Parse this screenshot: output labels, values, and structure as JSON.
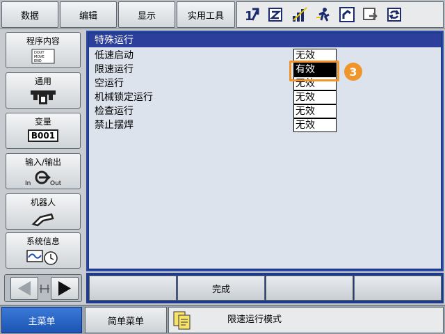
{
  "top_menu": {
    "items": [
      {
        "label": "数据"
      },
      {
        "label": "编辑"
      },
      {
        "label": "显示"
      },
      {
        "label": "实用工具"
      }
    ],
    "status_icons": [
      "step-mode-icon",
      "edit-lock-icon",
      "signal-level-icon",
      "running-person-icon",
      "robot-frame-icon",
      "pendant-mode-icon",
      "cycle-icon"
    ]
  },
  "sidebar": {
    "items": [
      {
        "label": "程序内容",
        "icon_text": [
          "DOUT",
          "MOVE",
          "END"
        ]
      },
      {
        "label": "通用"
      },
      {
        "label": "变量",
        "icon_text": "B001"
      },
      {
        "label": "输入/输出",
        "icon_in": "In",
        "icon_out": "Out"
      },
      {
        "label": "机器人"
      },
      {
        "label": "系统信息"
      }
    ]
  },
  "panel": {
    "title": "特殊运行",
    "rows": [
      {
        "label": "低速启动",
        "value": "无效"
      },
      {
        "label": "限速运行",
        "value": "有效"
      },
      {
        "label": "空运行",
        "value": "无效"
      },
      {
        "label": "机械锁定运行",
        "value": "无效"
      },
      {
        "label": "检查运行",
        "value": "无效"
      },
      {
        "label": "禁止摆焊",
        "value": "无效"
      }
    ],
    "selected_row_index": 1,
    "step_badge": "3",
    "highlight_color": "#f0952a"
  },
  "function_buttons": [
    "",
    "完成",
    "",
    ""
  ],
  "footer": {
    "main_menu": "主菜单",
    "simple_menu": "简单菜单",
    "message": "限速运行模式"
  },
  "colors": {
    "panel_blue": "#1e3a8a",
    "title_bar": "#2c3f9a",
    "main_menu_blue": "#2a66c8"
  }
}
